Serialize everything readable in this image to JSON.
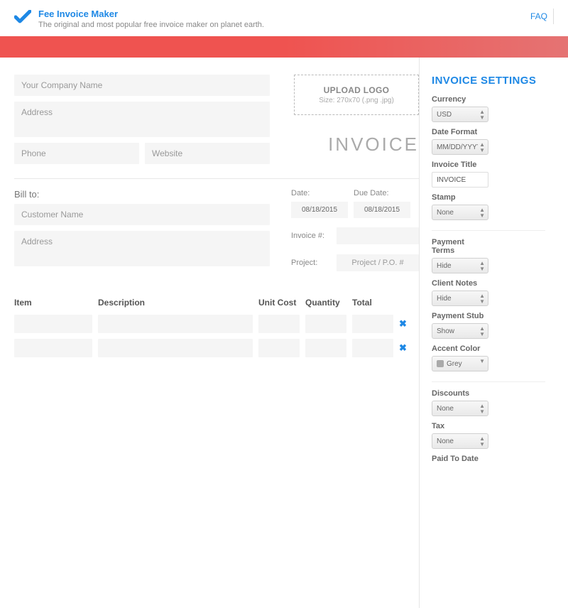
{
  "header": {
    "brand": "Fee Invoice Maker",
    "tagline": "The original and most popular free invoice maker on planet earth.",
    "faq": "FAQ"
  },
  "form": {
    "company_ph": "Your Company Name",
    "company_addr_ph": "Address",
    "phone_ph": "Phone",
    "website_ph": "Website",
    "upload_title": "UPLOAD LOGO",
    "upload_sub": "Size: 270x70 (.png .jpg)",
    "invoice_heading": "INVOICE",
    "billto_label": "Bill to:",
    "customer_ph": "Customer Name",
    "customer_addr_ph": "Address",
    "date_label": "Date:",
    "due_label": "Due Date:",
    "date_val": "08/18/2015",
    "due_val": "08/18/2015",
    "invno_label": "Invoice #:",
    "invno_val": "",
    "project_label": "Project:",
    "project_ph": "Project / P.O. #",
    "cols": {
      "item": "Item",
      "desc": "Description",
      "unit": "Unit Cost",
      "qty": "Quantity",
      "total": "Total"
    },
    "del_glyph": "✖"
  },
  "settings": {
    "title": "INVOICE SETTINGS",
    "currency_lbl": "Currency",
    "currency_val": "USD",
    "datefmt_lbl": "Date Format",
    "datefmt_val": "MM/DD/YYYY",
    "invtitle_lbl": "Invoice Title",
    "invtitle_val": "INVOICE",
    "stamp_lbl": "Stamp",
    "stamp_val": "None",
    "terms_lbl": "Payment Terms",
    "terms_val": "Hide",
    "notes_lbl": "Client Notes",
    "notes_val": "Hide",
    "stub_lbl": "Payment Stub",
    "stub_val": "Show",
    "accent_lbl": "Accent Color",
    "accent_val": "Grey",
    "disc_lbl": "Discounts",
    "disc_val": "None",
    "tax_lbl": "Tax",
    "tax_val": "None",
    "paidto_lbl": "Paid To Date"
  }
}
